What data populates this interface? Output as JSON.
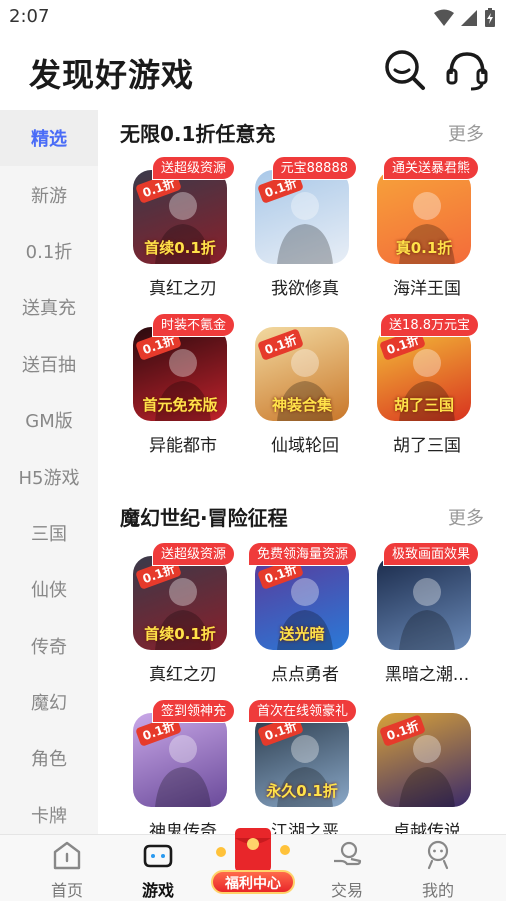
{
  "status_bar": {
    "time": "2:07"
  },
  "header": {
    "title": "发现好游戏"
  },
  "sidebar": {
    "items": [
      {
        "label": "精选",
        "active": true
      },
      {
        "label": "新游"
      },
      {
        "label": "0.1折"
      },
      {
        "label": "送真充"
      },
      {
        "label": "送百抽"
      },
      {
        "label": "GM版"
      },
      {
        "label": "H5游戏"
      },
      {
        "label": "三国"
      },
      {
        "label": "仙侠"
      },
      {
        "label": "传奇"
      },
      {
        "label": "魔幻"
      },
      {
        "label": "角色"
      },
      {
        "label": "卡牌"
      }
    ]
  },
  "sections": [
    {
      "title": "无限0.1折任意充",
      "more": "更多",
      "games": [
        {
          "name": "真红之刃",
          "tag": "送超级资源",
          "discount": "0.1折",
          "corner": "首续0.1折",
          "colors": [
            "#3a3a4a",
            "#8a1f2a"
          ]
        },
        {
          "name": "我欲修真",
          "tag": "元宝88888",
          "discount": "0.1折",
          "corner": "",
          "colors": [
            "#a9c8e8",
            "#e8eef6"
          ]
        },
        {
          "name": "海洋王国",
          "tag": "通关送暴君熊",
          "discount": "",
          "corner": "真0.1折",
          "colors": [
            "#f7a23a",
            "#f36b3a"
          ]
        },
        {
          "name": "异能都市",
          "tag": "时装不氪金",
          "discount": "0.1折",
          "corner": "首元免充版",
          "colors": [
            "#2a0a0e",
            "#c2222c"
          ]
        },
        {
          "name": "仙域轮回",
          "tag": "",
          "discount": "0.1折",
          "corner": "神装合集",
          "colors": [
            "#f2d9a0",
            "#c9772a"
          ]
        },
        {
          "name": "胡了三国",
          "tag": "送18.8万元宝",
          "discount": "0.1折",
          "corner": "胡了三国",
          "colors": [
            "#f4c23a",
            "#d8331f"
          ]
        }
      ]
    },
    {
      "title": "魔幻世纪·冒险征程",
      "more": "更多",
      "games": [
        {
          "name": "真红之刃",
          "tag": "送超级资源",
          "discount": "0.1折",
          "corner": "首续0.1折",
          "colors": [
            "#3a3a4a",
            "#8a1f2a"
          ]
        },
        {
          "name": "点点勇者",
          "tag": "免费领海量资源",
          "discount": "0.1折",
          "corner": "送光暗",
          "colors": [
            "#5a3a9a",
            "#2a7ad8"
          ]
        },
        {
          "name": "黑暗之潮...",
          "tag": "极致画面效果",
          "discount": "",
          "corner": "",
          "colors": [
            "#1a2a4a",
            "#6a8ab8"
          ]
        },
        {
          "name": "神鬼传奇",
          "tag": "签到领神充",
          "discount": "0.1折",
          "corner": "",
          "colors": [
            "#c9a8e8",
            "#6a4a9a"
          ]
        },
        {
          "name": "江湖之恶",
          "tag": "首次在线领豪礼",
          "discount": "0.1折",
          "corner": "永久0.1折",
          "colors": [
            "#2a3a4a",
            "#8aa8c8"
          ]
        },
        {
          "name": "卓越传说",
          "tag": "",
          "discount": "0.1折",
          "corner": "",
          "colors": [
            "#d8a23a",
            "#3a2a6a"
          ]
        }
      ]
    }
  ],
  "tabbar": {
    "items": [
      {
        "label": "首页",
        "icon": "home-icon"
      },
      {
        "label": "游戏",
        "icon": "gamepad-icon",
        "active": true
      },
      {
        "label": "交易",
        "icon": "trade-icon"
      },
      {
        "label": "我的",
        "icon": "profile-icon"
      }
    ],
    "welfare_label": "福利中心"
  },
  "colors": {
    "accent": "#4a6cf7",
    "tag_red": "#ef3b3b",
    "sidebar_bg": "#f5f5f5"
  }
}
